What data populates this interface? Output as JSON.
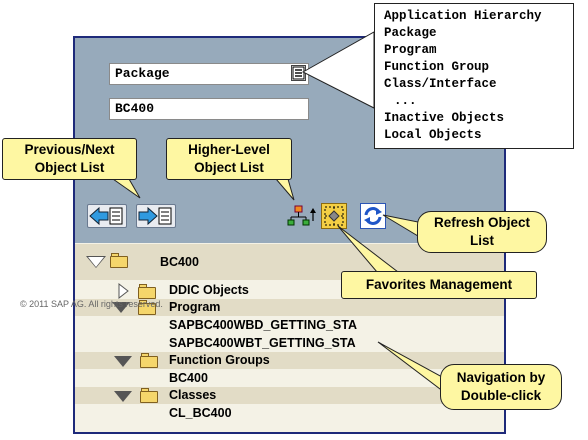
{
  "selector": {
    "object_type": "Package",
    "object_name": "BC400"
  },
  "dropdown": {
    "options": [
      "Application Hierarchy",
      "Package",
      "Program",
      "Function Group",
      "Class/Interface",
      "...",
      "Inactive Objects",
      "Local Objects"
    ]
  },
  "tree": {
    "root": "BC400",
    "items": [
      "DDIC Objects",
      "Program",
      "SAPBC400WBD_GETTING_STA",
      "SAPBC400WBT_GETTING_STA",
      "Function Groups",
      "BC400",
      "Classes",
      "CL_BC400"
    ]
  },
  "callouts": {
    "prev_next": [
      "Previous/Next",
      "Object List"
    ],
    "higher_level": [
      "Higher-Level",
      "Object List"
    ],
    "refresh": [
      "Refresh Object",
      "List"
    ],
    "favorites": "Favorites Management",
    "navigation": [
      "Navigation by",
      "Double-click"
    ]
  },
  "copyright": "© 2011 SAP AG. All rights reserved."
}
